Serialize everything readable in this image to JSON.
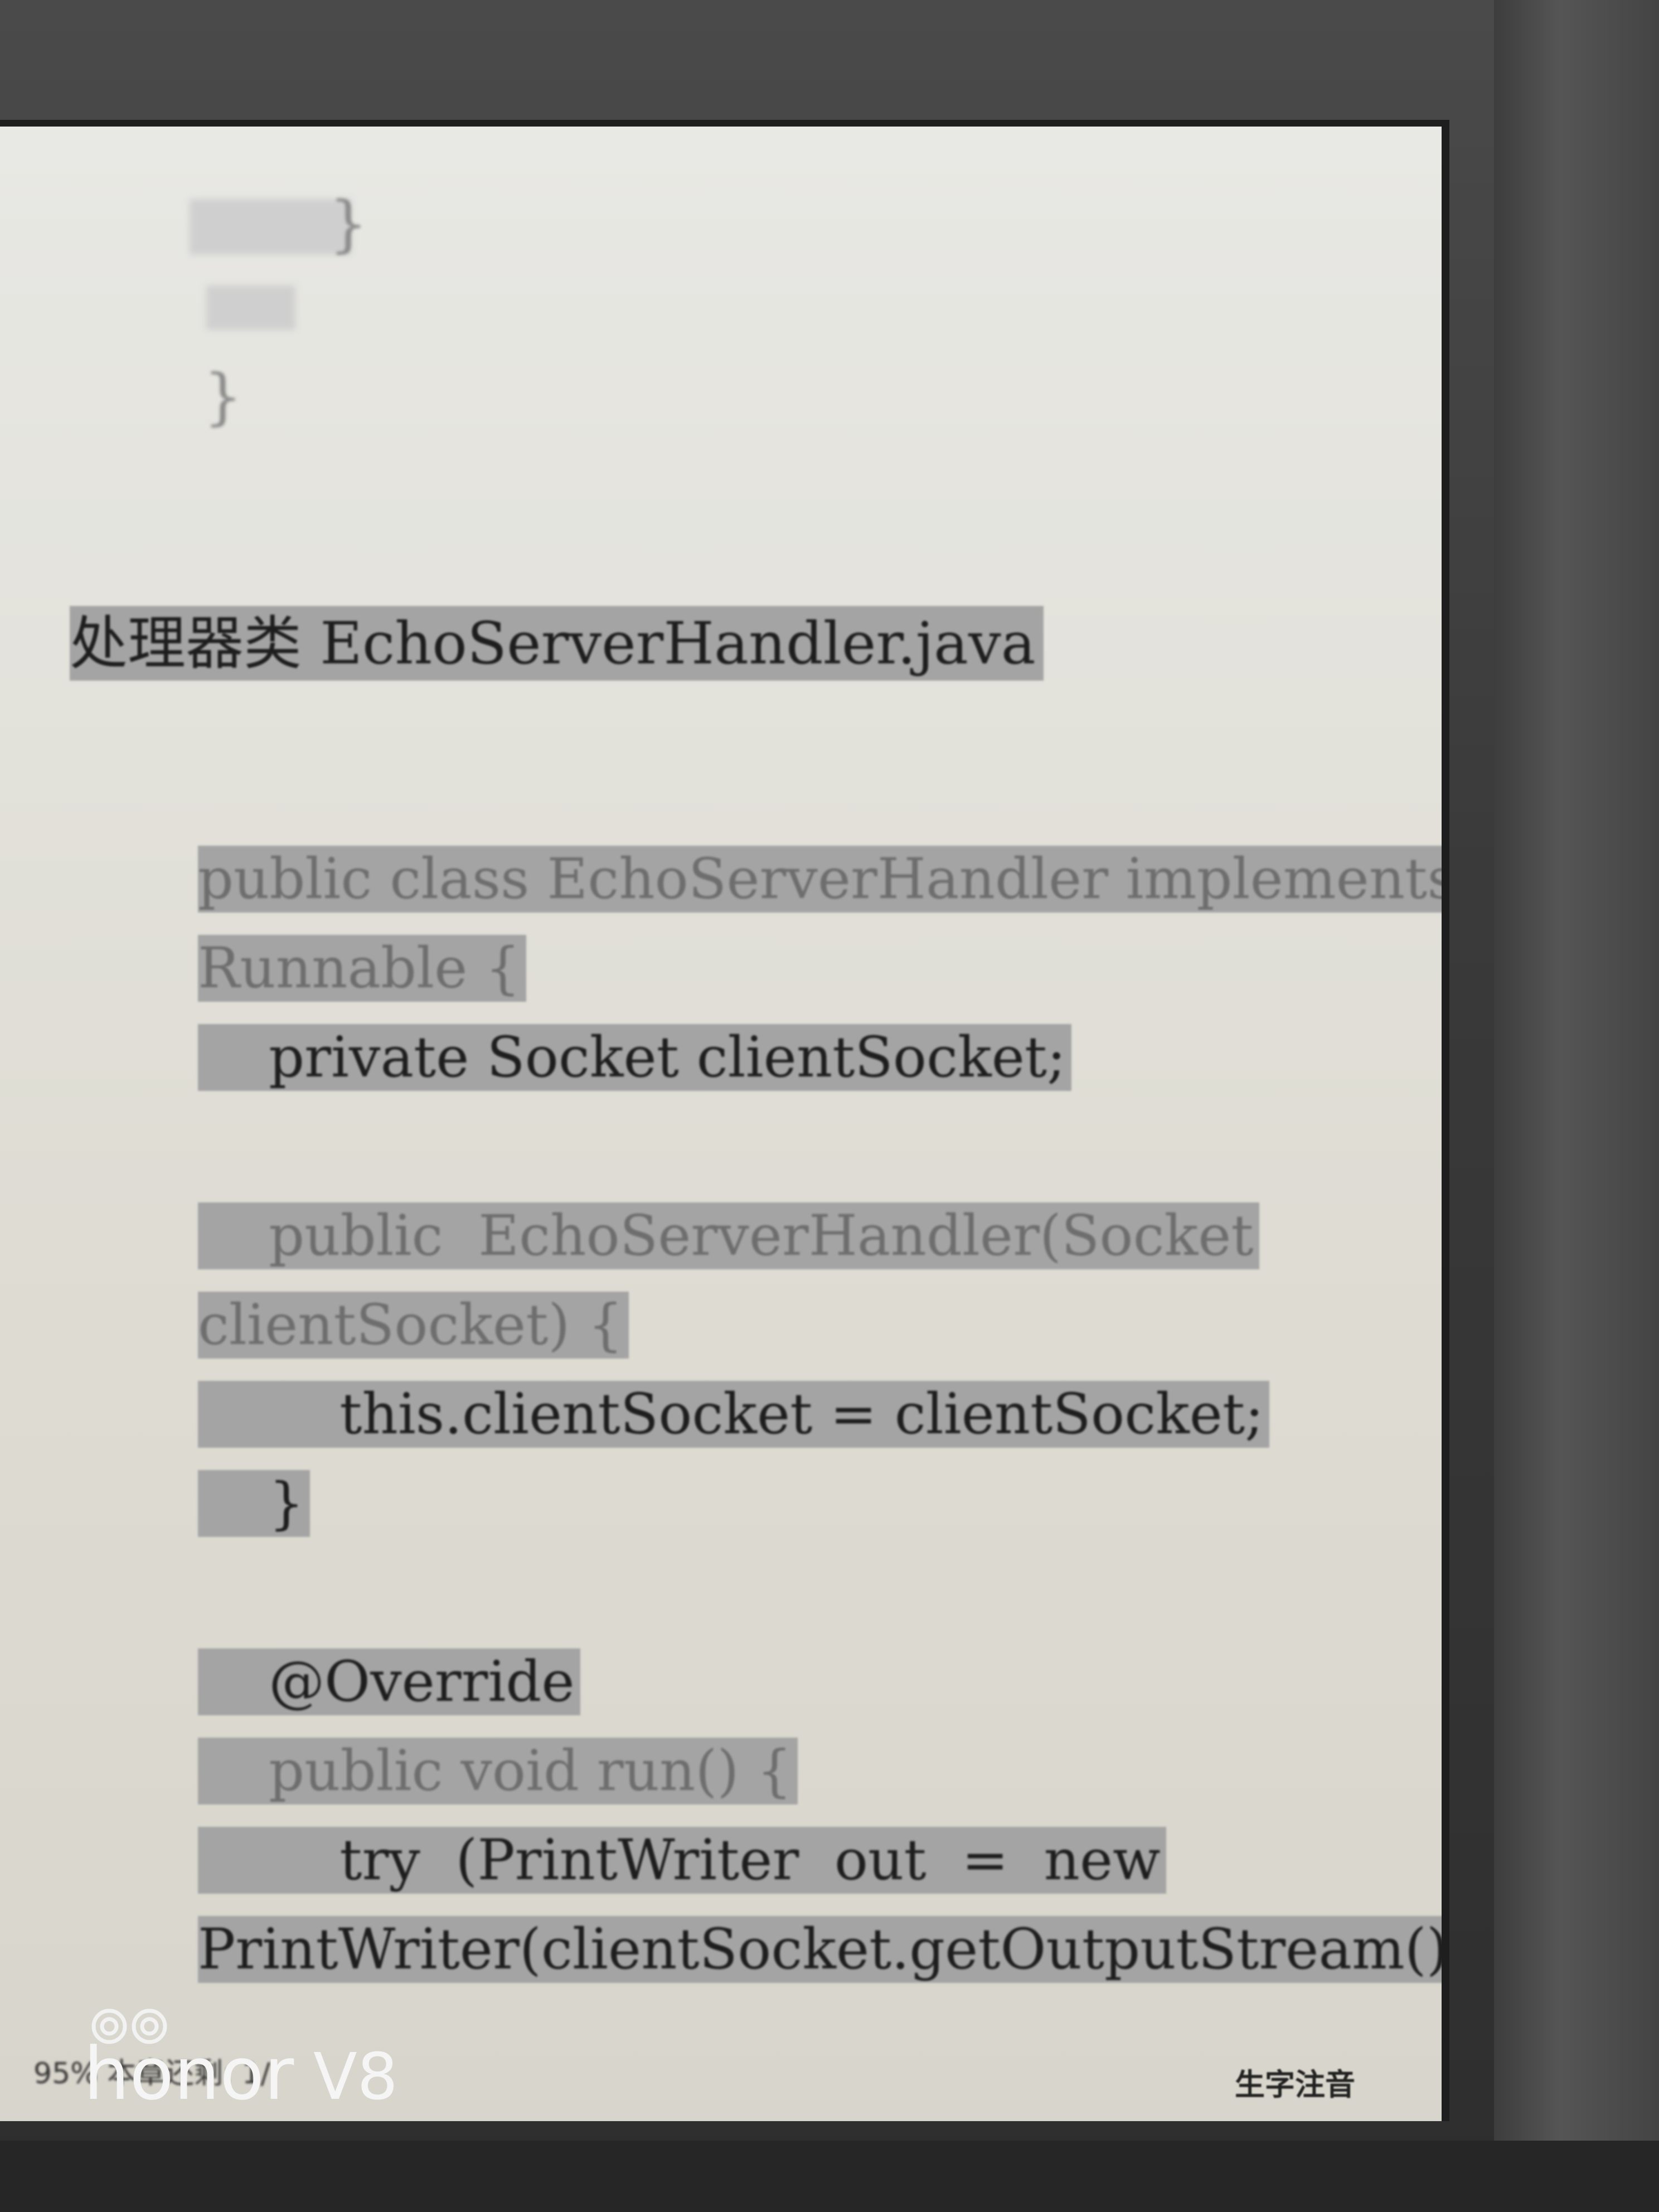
{
  "reader": {
    "heading": "处理器类 EchoServerHandler.java",
    "code_lines": [
      "public class EchoServerHandler implements",
      "Runnable {",
      "    private Socket clientSocket;",
      "    public  EchoServerHandler(Socket",
      "clientSocket) {",
      "        this.clientSocket = clientSocket;",
      "    }",
      "    @Override",
      "    public void run() {",
      "        try  (PrintWriter  out  =  new",
      "PrintWriter(clientSocket.getOutputStream(),"
    ],
    "top_fragments": [
      "}",
      "}"
    ],
    "status_left": "95%  本章还剩: 1/",
    "status_right": "生字注音"
  },
  "watermark": {
    "brand": "honor",
    "model": "V8"
  }
}
